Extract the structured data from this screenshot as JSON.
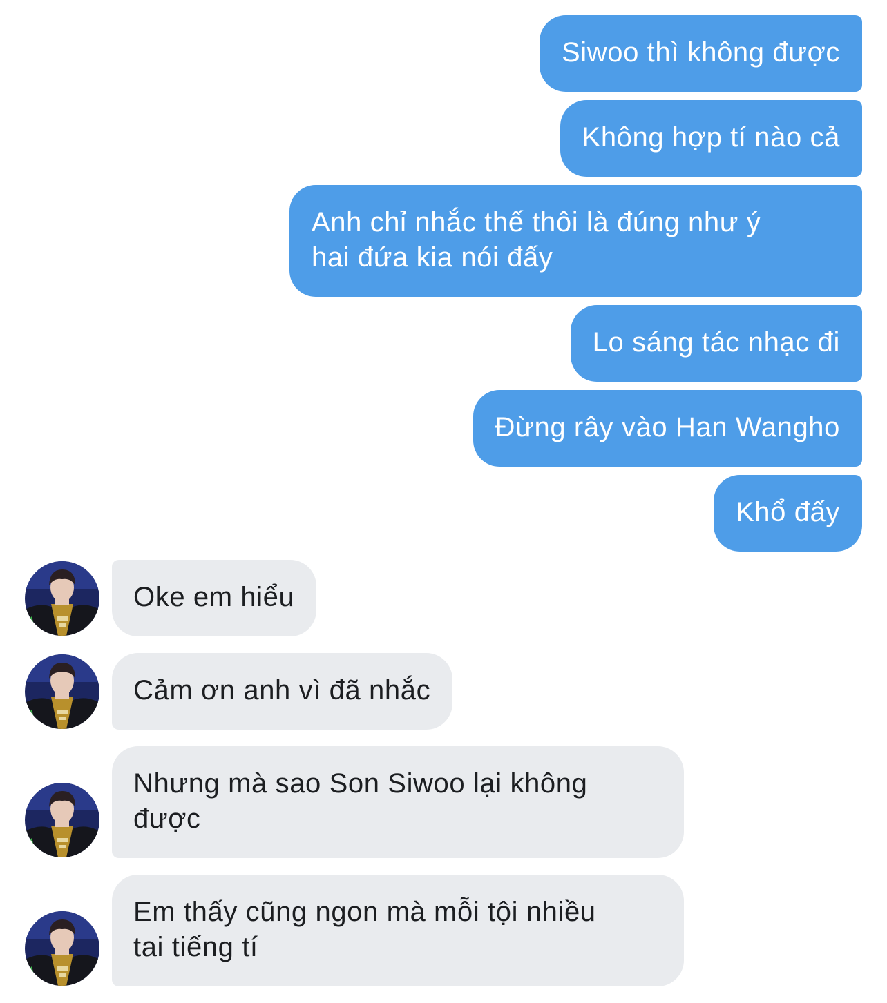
{
  "messages": [
    {
      "side": "out",
      "text": "Siwoo thì không được"
    },
    {
      "side": "out",
      "text": "Không hợp tí nào cả"
    },
    {
      "side": "out",
      "lines": [
        "Anh chỉ nhắc thế thôi là đúng như ý",
        "hai đứa kia nói đấy"
      ]
    },
    {
      "side": "out",
      "text": "Lo sáng tác nhạc đi"
    },
    {
      "side": "out",
      "text": "Đừng rây vào Han Wangho"
    },
    {
      "side": "out",
      "text": "Khổ đấy"
    },
    {
      "side": "in",
      "text": "Oke em hiểu"
    },
    {
      "side": "in",
      "text": "Cảm ơn anh vì đã nhắc"
    },
    {
      "side": "in",
      "lines": [
        "Nhưng mà sao Son Siwoo lại không",
        "được"
      ]
    },
    {
      "side": "in",
      "lines": [
        "Em thấy cũng ngon mà mỗi tội nhiều",
        "tai tiếng tí"
      ]
    }
  ],
  "contact": {
    "avatar_icon": "profile-photo-avatar"
  },
  "colors": {
    "outgoing_bubble": "#4e9de8",
    "incoming_bubble": "#e9ebee",
    "incoming_text": "#1c1e21",
    "background": "#ffffff"
  }
}
